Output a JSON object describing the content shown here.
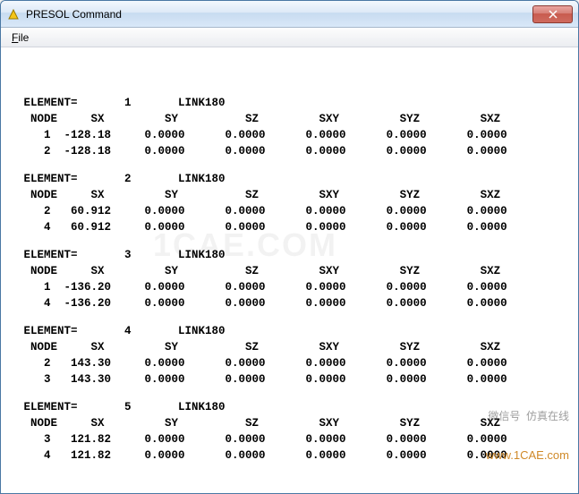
{
  "window": {
    "title": "PRESOL  Command"
  },
  "menu": {
    "file": "File"
  },
  "headers": {
    "element": "ELEMENT=",
    "link": "LINK180",
    "node": "NODE",
    "sx": "SX",
    "sy": "SY",
    "sz": "SZ",
    "sxy": "SXY",
    "syz": "SYZ",
    "sxz": "SXZ"
  },
  "elements": [
    {
      "id": "1",
      "rows": [
        {
          "node": "1",
          "sx": "-128.18",
          "sy": "0.0000",
          "sz": "0.0000",
          "sxy": "0.0000",
          "syz": "0.0000",
          "sxz": "0.0000"
        },
        {
          "node": "2",
          "sx": "-128.18",
          "sy": "0.0000",
          "sz": "0.0000",
          "sxy": "0.0000",
          "syz": "0.0000",
          "sxz": "0.0000"
        }
      ]
    },
    {
      "id": "2",
      "rows": [
        {
          "node": "2",
          "sx": "60.912",
          "sy": "0.0000",
          "sz": "0.0000",
          "sxy": "0.0000",
          "syz": "0.0000",
          "sxz": "0.0000"
        },
        {
          "node": "4",
          "sx": "60.912",
          "sy": "0.0000",
          "sz": "0.0000",
          "sxy": "0.0000",
          "syz": "0.0000",
          "sxz": "0.0000"
        }
      ]
    },
    {
      "id": "3",
      "rows": [
        {
          "node": "1",
          "sx": "-136.20",
          "sy": "0.0000",
          "sz": "0.0000",
          "sxy": "0.0000",
          "syz": "0.0000",
          "sxz": "0.0000"
        },
        {
          "node": "4",
          "sx": "-136.20",
          "sy": "0.0000",
          "sz": "0.0000",
          "sxy": "0.0000",
          "syz": "0.0000",
          "sxz": "0.0000"
        }
      ]
    },
    {
      "id": "4",
      "rows": [
        {
          "node": "2",
          "sx": "143.30",
          "sy": "0.0000",
          "sz": "0.0000",
          "sxy": "0.0000",
          "syz": "0.0000",
          "sxz": "0.0000"
        },
        {
          "node": "3",
          "sx": "143.30",
          "sy": "0.0000",
          "sz": "0.0000",
          "sxy": "0.0000",
          "syz": "0.0000",
          "sxz": "0.0000"
        }
      ]
    },
    {
      "id": "5",
      "rows": [
        {
          "node": "3",
          "sx": "121.82",
          "sy": "0.0000",
          "sz": "0.0000",
          "sxy": "0.0000",
          "syz": "0.0000",
          "sxz": "0.0000"
        },
        {
          "node": "4",
          "sx": "121.82",
          "sy": "0.0000",
          "sz": "0.0000",
          "sxy": "0.0000",
          "syz": "0.0000",
          "sxz": "0.0000"
        }
      ]
    }
  ],
  "watermark": {
    "line1": "微信号  仿真在线",
    "line2": "www.1CAE.com",
    "bg": "1CAE.COM"
  }
}
